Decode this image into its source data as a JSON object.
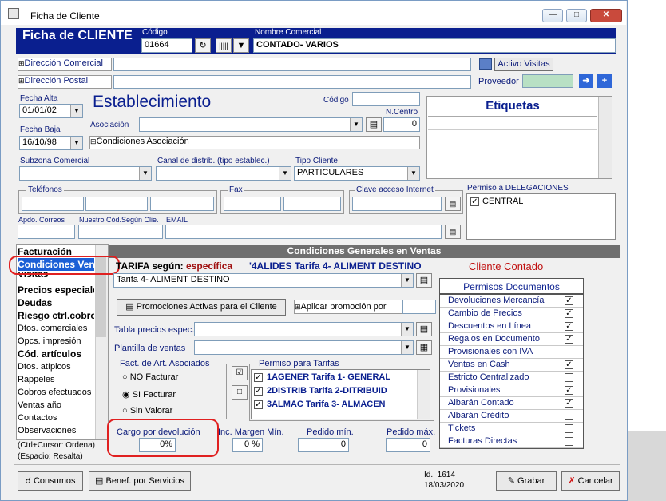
{
  "window": {
    "title": "Ficha de Cliente"
  },
  "header": {
    "title": "Ficha de CLIENTE",
    "codigo_label": "Código",
    "codigo_value": "01664",
    "nombre_label": "Nombre Comercial",
    "nombre_value": "CONTADO- VARIOS"
  },
  "address": {
    "comercial_label": "Dirección Comercial",
    "postal_label": "Dirección Postal",
    "activo_visitas": "Activo Visitas",
    "proveedor_label": "Proveedor"
  },
  "dates": {
    "alta_label": "Fecha Alta",
    "alta_value": "01/01/02",
    "baja_label": "Fecha Baja",
    "baja_value": "16/10/98"
  },
  "establecimiento": {
    "title": "Establecimiento",
    "codigo_label": "Código",
    "ncentro_label": "N.Centro",
    "ncentro_value": "0",
    "asociacion_label": "Asociación",
    "condiciones_asociacion": "Condiciones Asociación"
  },
  "etiquetas": {
    "title": "Etiquetas"
  },
  "subzona": {
    "subzona_label": "Subzona Comercial",
    "canal_label": "Canal de distrib. (tipo establec.)",
    "tipo_label": "Tipo Cliente",
    "tipo_value": "PARTICULARES"
  },
  "contact": {
    "telefonos_label": "Teléfonos",
    "fax_label": "Fax",
    "clave_label": "Clave acceso Internet",
    "apdo_label": "Apdo. Correos",
    "cod_label": "Nuestro Cód.Según Clie.",
    "email_label": "EMAIL"
  },
  "delegaciones": {
    "label": "Permiso a DELEGACIONES",
    "items": [
      "CENTRAL"
    ]
  },
  "nav": {
    "items": [
      {
        "label": "Facturación",
        "bold": true
      },
      {
        "label": "Condiciones Ventas",
        "bold": true,
        "selected": true
      },
      {
        "label": "Visitas",
        "bold": true
      },
      {
        "label": "Precios especiales",
        "bold": true
      },
      {
        "label": "Deudas",
        "bold": true
      },
      {
        "label": "Riesgo ctrl.cobro",
        "bold": true
      },
      {
        "label": "Dtos. comerciales",
        "bold": false
      },
      {
        "label": "Opcs. impresión",
        "bold": false
      },
      {
        "label": "Cód. artículos",
        "bold": true
      },
      {
        "label": "Dtos. atípicos",
        "bold": false
      },
      {
        "label": "Rappeles",
        "bold": false
      },
      {
        "label": "Cobros efectuados",
        "bold": false
      },
      {
        "label": "Ventas año",
        "bold": false
      },
      {
        "label": "Contactos",
        "bold": false
      },
      {
        "label": "Observaciones",
        "bold": false
      }
    ],
    "hint1": "(Ctrl+Cursor: Ordena)",
    "hint2": "(Espacio: Resalta)"
  },
  "conditions": {
    "section_title": "Condiciones Generales en Ventas",
    "tarifa_label": "TARIFA según:",
    "tarifa_tipo": "específica",
    "tarifa_code": "'4ALIDES Tarifa 4- ALIMENT DESTINO",
    "cliente_contado": "Cliente Contado",
    "tarifa_select": "Tarifa 4- ALIMENT DESTINO",
    "promo_button": "Promociones Activas para el Cliente",
    "aplicar_promo": "Aplicar promoción por",
    "tabla_precios": "Tabla precios espec.",
    "plantilla_ventas": "Plantilla de ventas",
    "fact_label": "Fact. de Art. Asociados",
    "radios": [
      {
        "label": "NO  Facturar",
        "checked": false
      },
      {
        "label": "SI  Facturar",
        "checked": true
      },
      {
        "label": "Sin  Valorar",
        "checked": false
      }
    ],
    "permiso_tarifas_label": "Permiso para Tarifas",
    "tarifas": [
      "1AGENER Tarifa 1- GENERAL",
      "2DISTRIB Tarifa 2-DITRIBUID(",
      "3ALMAC Tarifa 3- ALMACEN"
    ],
    "cargo_label": "Cargo por devolución",
    "cargo_value": "0%",
    "inc_margen_label": "Inc. Margen Mín.",
    "inc_margen_value": "0 %",
    "pedido_min_label": "Pedido mín.",
    "pedido_min_value": "0",
    "pedido_max_label": "Pedido máx.",
    "pedido_max_value": "0"
  },
  "permisos": {
    "title": "Permisos Documentos",
    "items": [
      {
        "label": "Devoluciones Mercancía",
        "checked": true
      },
      {
        "label": "Cambio de Precios",
        "checked": true
      },
      {
        "label": "Descuentos en Línea",
        "checked": true
      },
      {
        "label": "Regalos en Documento",
        "checked": true
      },
      {
        "label": "Provisionales con IVA",
        "checked": false
      },
      {
        "label": "Ventas en Cash",
        "checked": true
      },
      {
        "label": "Estricto Centralizado",
        "checked": false
      },
      {
        "label": "Provisionales",
        "checked": true
      },
      {
        "label": "Albarán Contado",
        "checked": true
      },
      {
        "label": "Albarán Crédito",
        "checked": false
      },
      {
        "label": "Tickets",
        "checked": false
      },
      {
        "label": "Facturas Directas",
        "checked": false
      }
    ]
  },
  "footer": {
    "consumos": "Consumos",
    "benef": "Benef. por Servicios",
    "id_text": "Id.: 1614",
    "date_text": "18/03/2020",
    "grabar": "Grabar",
    "cancelar": "Cancelar"
  },
  "colors": {
    "accent_blue": "#0a1f8f",
    "section_gray": "#6f6f6f",
    "highlight_red": "#e02020"
  }
}
